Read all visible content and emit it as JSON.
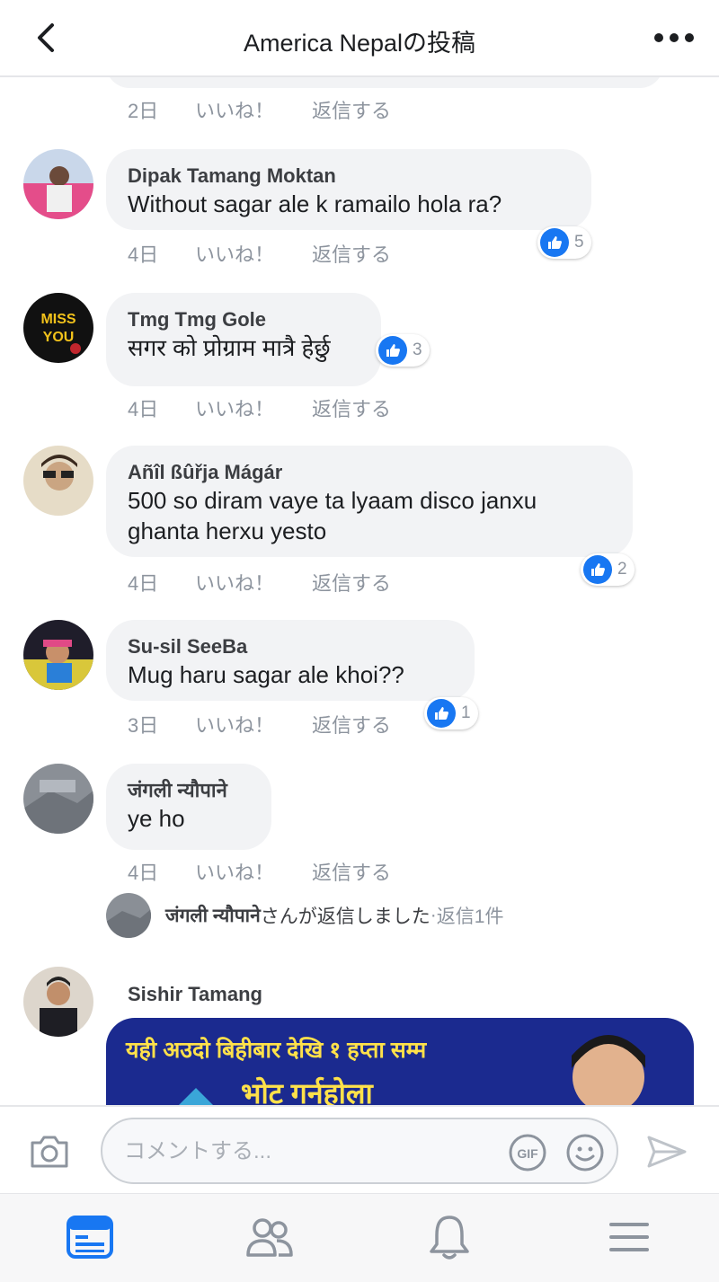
{
  "header": {
    "title": "America Nepalの投稿",
    "back_icon": "chevron-left-icon",
    "more_icon": "ellipsis-icon"
  },
  "actions": {
    "like": "いいね！",
    "reply": "返信する"
  },
  "top_meta": {
    "time": "2日"
  },
  "comments": [
    {
      "name": "Dipak Tamang Moktan",
      "text": [
        "Without sagar ale k ramailo hola ra?"
      ],
      "time": "4日",
      "likes": "5"
    },
    {
      "name": "Tmg Tmg Gole",
      "text": [
        "सगर को प्रोग्राम मात्रै हेर्छु"
      ],
      "time": "4日",
      "likes": "3"
    },
    {
      "name": "Añîl ßûřja Mágár",
      "text": [
        "500 so diram vaye ta lyaam disco janxu",
        "ghanta herxu yesto"
      ],
      "time": "4日",
      "likes": "2"
    },
    {
      "name": "Su-sil SeeBa",
      "text": [
        "Mug haru sagar ale khoi??"
      ],
      "time": "3日",
      "likes": "1"
    },
    {
      "name": "जंगली न्यौपाने",
      "text": [
        "ye ho"
      ],
      "time": "4日"
    }
  ],
  "reply_summary": {
    "name": "जंगली न्यौपाने",
    "text": "さんが返信しました",
    "separator": " · ",
    "count": "返信1件"
  },
  "last_comment": {
    "name": "Sishir Tamang",
    "banner_line1": "यही अउदो बिहीबार देखि १ हप्ता सम्म",
    "banner_line2": "भोट गर्नहोला"
  },
  "composer": {
    "placeholder": "コメントする...",
    "gif_label": "GIF"
  },
  "tabs": [
    "news-feed-icon",
    "friends-icon",
    "notifications-icon",
    "menu-icon"
  ],
  "colors": {
    "accent": "#1877f2",
    "bubble": "#f2f3f5",
    "meta": "#8d949e"
  }
}
